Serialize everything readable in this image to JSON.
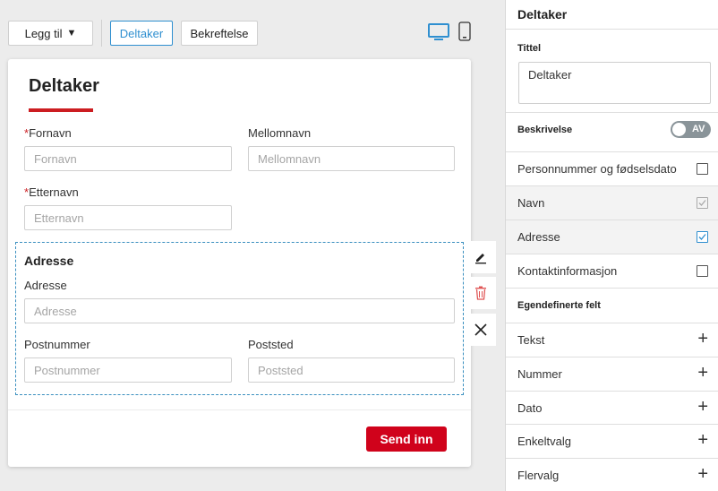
{
  "toolbar": {
    "add_label": "Legg til",
    "tab_deltaker": "Deltaker",
    "tab_bekreftelse": "Bekreftelse"
  },
  "form": {
    "title": "Deltaker",
    "required_mark": "*",
    "fornavn": {
      "label": "Fornavn",
      "placeholder": "Fornavn"
    },
    "mellomnavn": {
      "label": "Mellomnavn",
      "placeholder": "Mellomnavn"
    },
    "etternavn": {
      "label": "Etternavn",
      "placeholder": "Etternavn"
    },
    "address_section": {
      "title": "Adresse",
      "adresse": {
        "label": "Adresse",
        "placeholder": "Adresse"
      },
      "postnummer": {
        "label": "Postnummer",
        "placeholder": "Postnummer"
      },
      "poststed": {
        "label": "Poststed",
        "placeholder": "Poststed"
      }
    },
    "submit_label": "Send inn"
  },
  "panel": {
    "title": "Deltaker",
    "tittel_label": "Tittel",
    "tittel_value": "Deltaker",
    "beskrivelse_label": "Beskrivelse",
    "beskrivelse_toggle": "AV",
    "fields": [
      {
        "label": "Personnummer og fødselsdato",
        "checked": false
      },
      {
        "label": "Navn",
        "checked": true
      },
      {
        "label": "Adresse",
        "checked": true
      },
      {
        "label": "Kontaktinformasjon",
        "checked": false
      }
    ],
    "custom_label": "Egendefinerte felt",
    "custom_fields": [
      {
        "label": "Tekst"
      },
      {
        "label": "Nummer"
      },
      {
        "label": "Dato"
      },
      {
        "label": "Enkeltvalg"
      },
      {
        "label": "Flervalg"
      }
    ]
  },
  "colors": {
    "accent": "#2f8fd0",
    "brand_red": "#d0021b"
  },
  "icons": [
    "caret-down-icon",
    "desktop-icon",
    "mobile-icon",
    "pencil-icon",
    "trash-icon",
    "close-icon",
    "plus-icon",
    "checkbox-icon"
  ]
}
